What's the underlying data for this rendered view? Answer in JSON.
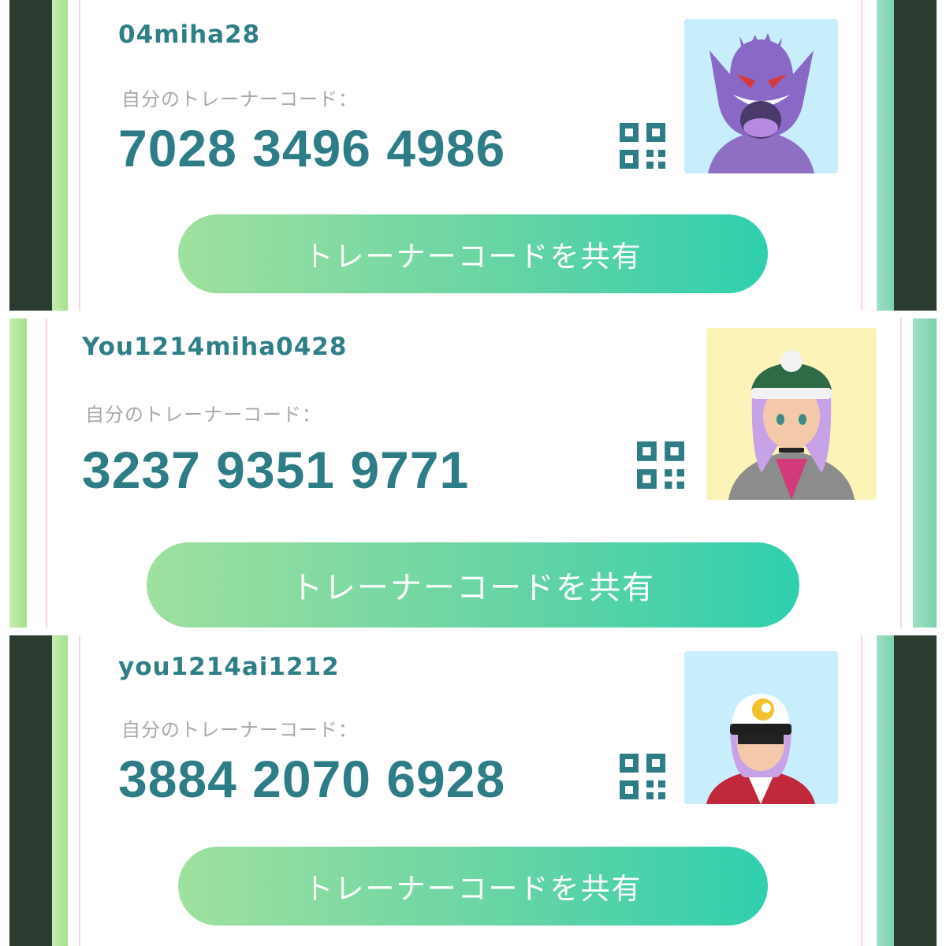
{
  "colors": {
    "accent_text": "#2f7f86",
    "label_gray": "#a9a9a9",
    "button_gradient_start": "#9fe09e",
    "button_gradient_end": "#2fcfae"
  },
  "panels": [
    {
      "username": "04miha28",
      "code_label": "自分のトレーナーコード：",
      "code": "7028 3496 4986",
      "qr_icon": "qr-code-icon",
      "avatar_bg": "#c9eefb",
      "share_label": "トレーナーコードを共有"
    },
    {
      "username": "You1214miha0428",
      "code_label": "自分のトレーナーコード：",
      "code": "3237 9351 9771",
      "qr_icon": "qr-code-icon",
      "avatar_bg": "#fbf3b8",
      "share_label": "トレーナーコードを共有"
    },
    {
      "username": "you1214ai1212",
      "code_label": "自分のトレーナーコード：",
      "code": "3884 2070 6928",
      "qr_icon": "qr-code-icon",
      "avatar_bg": "#c9eefb",
      "share_label": "トレーナーコードを共有"
    }
  ]
}
